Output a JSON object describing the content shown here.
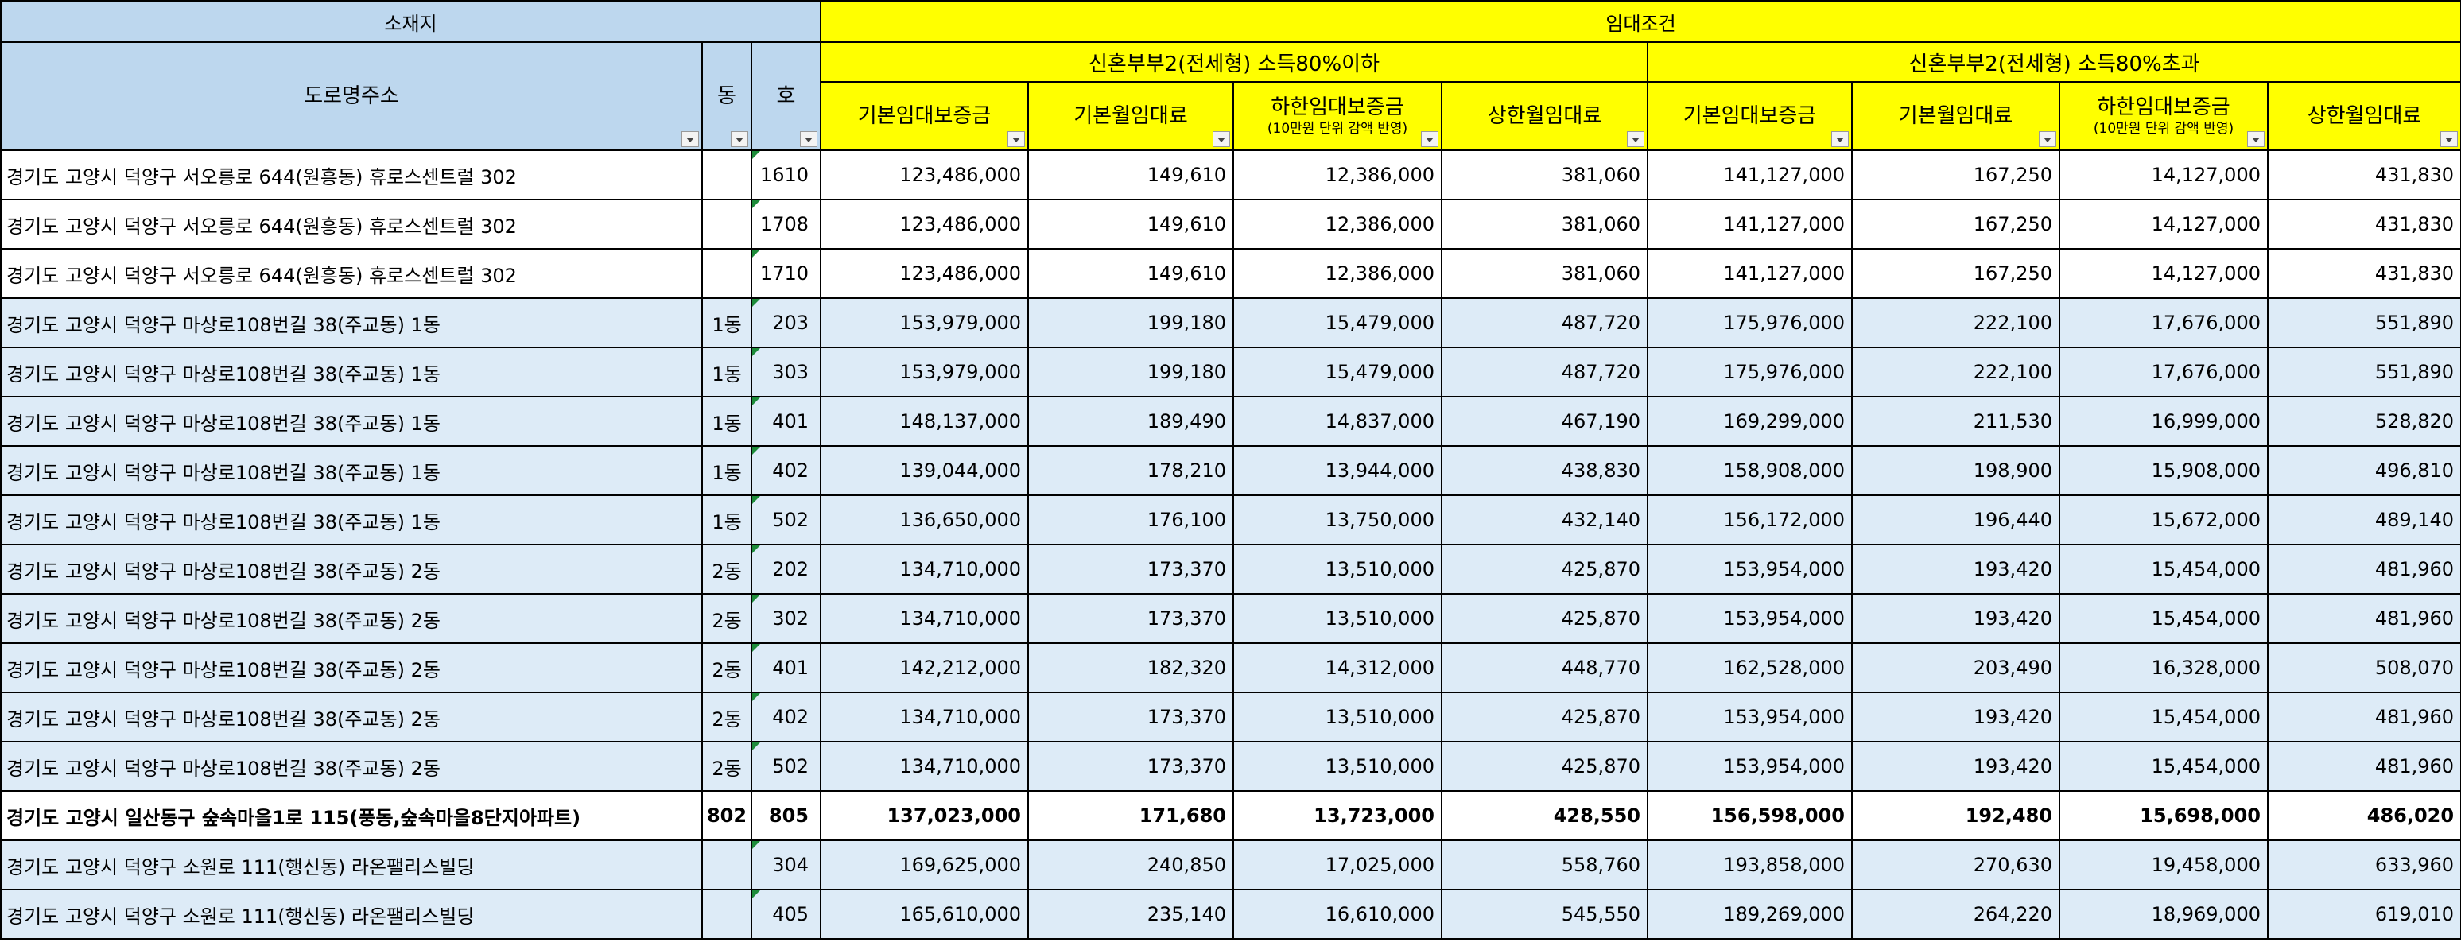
{
  "headers": {
    "location": "소재지",
    "lease_terms": "임대조건",
    "road_address": "도로명주소",
    "dong": "동",
    "ho": "호",
    "group_under80": "신혼부부2(전세형) 소득80%이하",
    "group_over80": "신혼부부2(전세형) 소득80%초과",
    "base_deposit": "기본임대보증금",
    "base_rent": "기본월임대료",
    "min_deposit": "하한임대보증금",
    "min_deposit_note": "(10만원 단위 감액 반영)",
    "max_rent": "상한월임대료"
  },
  "rows": [
    {
      "style": "white",
      "flag": true,
      "address": "경기도 고양시 덕양구 서오릉로 644(원흥동) 휴로스센트럴 302",
      "dong": "",
      "ho": "1610",
      "v": [
        "123,486,000",
        "149,610",
        "12,386,000",
        "381,060",
        "141,127,000",
        "167,250",
        "14,127,000",
        "431,830"
      ]
    },
    {
      "style": "white",
      "flag": true,
      "address": "경기도 고양시 덕양구 서오릉로 644(원흥동) 휴로스센트럴 302",
      "dong": "",
      "ho": "1708",
      "v": [
        "123,486,000",
        "149,610",
        "12,386,000",
        "381,060",
        "141,127,000",
        "167,250",
        "14,127,000",
        "431,830"
      ]
    },
    {
      "style": "white",
      "flag": true,
      "address": "경기도 고양시 덕양구 서오릉로 644(원흥동) 휴로스센트럴 302",
      "dong": "",
      "ho": "1710",
      "v": [
        "123,486,000",
        "149,610",
        "12,386,000",
        "381,060",
        "141,127,000",
        "167,250",
        "14,127,000",
        "431,830"
      ]
    },
    {
      "style": "blue",
      "flag": true,
      "address": "경기도 고양시 덕양구 마상로108번길 38(주교동) 1동",
      "dong": "1동",
      "ho": "203",
      "v": [
        "153,979,000",
        "199,180",
        "15,479,000",
        "487,720",
        "175,976,000",
        "222,100",
        "17,676,000",
        "551,890"
      ]
    },
    {
      "style": "blue",
      "flag": true,
      "address": "경기도 고양시 덕양구 마상로108번길 38(주교동) 1동",
      "dong": "1동",
      "ho": "303",
      "v": [
        "153,979,000",
        "199,180",
        "15,479,000",
        "487,720",
        "175,976,000",
        "222,100",
        "17,676,000",
        "551,890"
      ]
    },
    {
      "style": "blue",
      "flag": true,
      "address": "경기도 고양시 덕양구 마상로108번길 38(주교동) 1동",
      "dong": "1동",
      "ho": "401",
      "v": [
        "148,137,000",
        "189,490",
        "14,837,000",
        "467,190",
        "169,299,000",
        "211,530",
        "16,999,000",
        "528,820"
      ]
    },
    {
      "style": "blue",
      "flag": true,
      "address": "경기도 고양시 덕양구 마상로108번길 38(주교동) 1동",
      "dong": "1동",
      "ho": "402",
      "v": [
        "139,044,000",
        "178,210",
        "13,944,000",
        "438,830",
        "158,908,000",
        "198,900",
        "15,908,000",
        "496,810"
      ]
    },
    {
      "style": "blue",
      "flag": true,
      "address": "경기도 고양시 덕양구 마상로108번길 38(주교동) 1동",
      "dong": "1동",
      "ho": "502",
      "v": [
        "136,650,000",
        "176,100",
        "13,750,000",
        "432,140",
        "156,172,000",
        "196,440",
        "15,672,000",
        "489,140"
      ]
    },
    {
      "style": "blue",
      "flag": true,
      "address": "경기도 고양시 덕양구 마상로108번길 38(주교동) 2동",
      "dong": "2동",
      "ho": "202",
      "v": [
        "134,710,000",
        "173,370",
        "13,510,000",
        "425,870",
        "153,954,000",
        "193,420",
        "15,454,000",
        "481,960"
      ]
    },
    {
      "style": "blue",
      "flag": true,
      "address": "경기도 고양시 덕양구 마상로108번길 38(주교동) 2동",
      "dong": "2동",
      "ho": "302",
      "v": [
        "134,710,000",
        "173,370",
        "13,510,000",
        "425,870",
        "153,954,000",
        "193,420",
        "15,454,000",
        "481,960"
      ]
    },
    {
      "style": "blue",
      "flag": true,
      "address": "경기도 고양시 덕양구 마상로108번길 38(주교동) 2동",
      "dong": "2동",
      "ho": "401",
      "v": [
        "142,212,000",
        "182,320",
        "14,312,000",
        "448,770",
        "162,528,000",
        "203,490",
        "16,328,000",
        "508,070"
      ]
    },
    {
      "style": "blue",
      "flag": true,
      "address": "경기도 고양시 덕양구 마상로108번길 38(주교동) 2동",
      "dong": "2동",
      "ho": "402",
      "v": [
        "134,710,000",
        "173,370",
        "13,510,000",
        "425,870",
        "153,954,000",
        "193,420",
        "15,454,000",
        "481,960"
      ]
    },
    {
      "style": "blue",
      "flag": true,
      "address": "경기도 고양시 덕양구 마상로108번길 38(주교동) 2동",
      "dong": "2동",
      "ho": "502",
      "v": [
        "134,710,000",
        "173,370",
        "13,510,000",
        "425,870",
        "153,954,000",
        "193,420",
        "15,454,000",
        "481,960"
      ]
    },
    {
      "style": "bold",
      "flag": false,
      "address": "경기도 고양시 일산동구 숲속마을1로 115(풍동,숲속마을8단지아파트)",
      "dong": "802",
      "ho": "805",
      "v": [
        "137,023,000",
        "171,680",
        "13,723,000",
        "428,550",
        "156,598,000",
        "192,480",
        "15,698,000",
        "486,020"
      ]
    },
    {
      "style": "blue",
      "flag": true,
      "address": "경기도 고양시 덕양구 소원로 111(행신동) 라온팰리스빌딩",
      "dong": "",
      "ho": "304",
      "v": [
        "169,625,000",
        "240,850",
        "17,025,000",
        "558,760",
        "193,858,000",
        "270,630",
        "19,458,000",
        "633,960"
      ]
    },
    {
      "style": "blue",
      "flag": true,
      "address": "경기도 고양시 덕양구 소원로 111(행신동) 라온팰리스빌딩",
      "dong": "",
      "ho": "405",
      "v": [
        "165,610,000",
        "235,140",
        "16,610,000",
        "545,550",
        "189,269,000",
        "264,220",
        "18,969,000",
        "619,010"
      ]
    }
  ]
}
